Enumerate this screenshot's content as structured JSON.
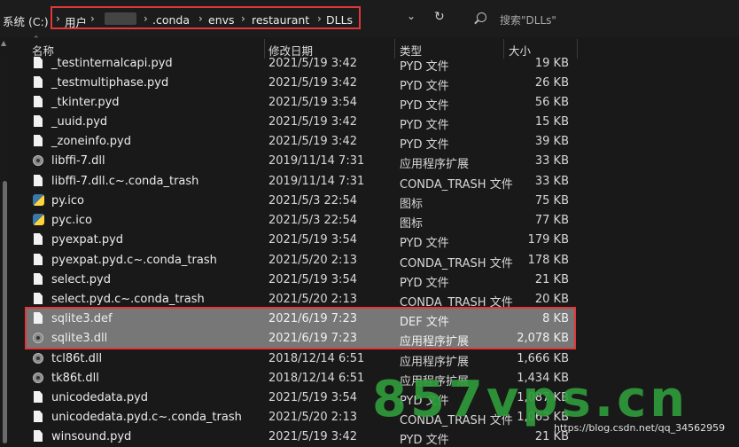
{
  "address_bar": {
    "drive_label": "系统 (C:)",
    "crumbs": [
      "用户",
      ".conda",
      "envs",
      "restaurant",
      "DLLs"
    ],
    "separator": "›",
    "search_placeholder": "搜索\"DLLs\""
  },
  "columns": {
    "name": "名称",
    "date": "修改日期",
    "type": "类型",
    "size": "大小"
  },
  "files": [
    {
      "name": "_testinternalcapi.pyd",
      "date": "2021/5/19 3:42",
      "type": "PYD 文件",
      "size": "19 KB",
      "icon": "file-icon"
    },
    {
      "name": "_testmultiphase.pyd",
      "date": "2021/5/19 3:42",
      "type": "PYD 文件",
      "size": "26 KB",
      "icon": "file-icon"
    },
    {
      "name": "_tkinter.pyd",
      "date": "2021/5/19 3:54",
      "type": "PYD 文件",
      "size": "56 KB",
      "icon": "file-icon"
    },
    {
      "name": "_uuid.pyd",
      "date": "2021/5/19 3:42",
      "type": "PYD 文件",
      "size": "15 KB",
      "icon": "file-icon"
    },
    {
      "name": "_zoneinfo.pyd",
      "date": "2021/5/19 3:42",
      "type": "PYD 文件",
      "size": "39 KB",
      "icon": "file-icon"
    },
    {
      "name": "libffi-7.dll",
      "date": "2019/11/14 7:31",
      "type": "应用程序扩展",
      "size": "33 KB",
      "icon": "gear-icon"
    },
    {
      "name": "libffi-7.dll.c~.conda_trash",
      "date": "2019/11/14 7:31",
      "type": "CONDA_TRASH 文件",
      "size": "33 KB",
      "icon": "file-icon"
    },
    {
      "name": "py.ico",
      "date": "2021/5/3 22:54",
      "type": "图标",
      "size": "75 KB",
      "icon": "python-icon"
    },
    {
      "name": "pyc.ico",
      "date": "2021/5/3 22:54",
      "type": "图标",
      "size": "77 KB",
      "icon": "python-icon"
    },
    {
      "name": "pyexpat.pyd",
      "date": "2021/5/19 3:54",
      "type": "PYD 文件",
      "size": "179 KB",
      "icon": "file-icon"
    },
    {
      "name": "pyexpat.pyd.c~.conda_trash",
      "date": "2021/5/20 2:13",
      "type": "CONDA_TRASH 文件",
      "size": "178 KB",
      "icon": "file-icon"
    },
    {
      "name": "select.pyd",
      "date": "2021/5/19 3:54",
      "type": "PYD 文件",
      "size": "21 KB",
      "icon": "file-icon"
    },
    {
      "name": "select.pyd.c~.conda_trash",
      "date": "2021/5/20 2:13",
      "type": "CONDA_TRASH 文件",
      "size": "20 KB",
      "icon": "file-icon"
    },
    {
      "name": "sqlite3.def",
      "date": "2021/6/19 7:23",
      "type": "DEF 文件",
      "size": "8 KB",
      "icon": "file-icon",
      "selected": true
    },
    {
      "name": "sqlite3.dll",
      "date": "2021/6/19 7:23",
      "type": "应用程序扩展",
      "size": "2,078 KB",
      "icon": "gear-icon",
      "selected": true
    },
    {
      "name": "tcl86t.dll",
      "date": "2018/12/14 6:51",
      "type": "应用程序扩展",
      "size": "1,666 KB",
      "icon": "gear-icon"
    },
    {
      "name": "tk86t.dll",
      "date": "2018/12/14 6:51",
      "type": "应用程序扩展",
      "size": "1,434 KB",
      "icon": "gear-icon"
    },
    {
      "name": "unicodedata.pyd",
      "date": "2021/5/19 3:54",
      "type": "PYD 文件",
      "size": "1,087 KB",
      "icon": "file-icon"
    },
    {
      "name": "unicodedata.pyd.c~.conda_trash",
      "date": "2021/5/20 2:13",
      "type": "CONDA_TRASH 文件",
      "size": "1,063 KB",
      "icon": "file-icon"
    },
    {
      "name": "winsound.pyd",
      "date": "2021/5/19 3:42",
      "type": "PYD 文件",
      "size": "21 KB",
      "icon": "file-icon"
    }
  ],
  "watermark": {
    "big": "857vps.cn",
    "small": "https://blog.csdn.net/qq_34562959"
  },
  "colors": {
    "background": "#191919",
    "selection": "#777777",
    "highlight_border": "#e1373a",
    "watermark": "#2f9b3b"
  }
}
